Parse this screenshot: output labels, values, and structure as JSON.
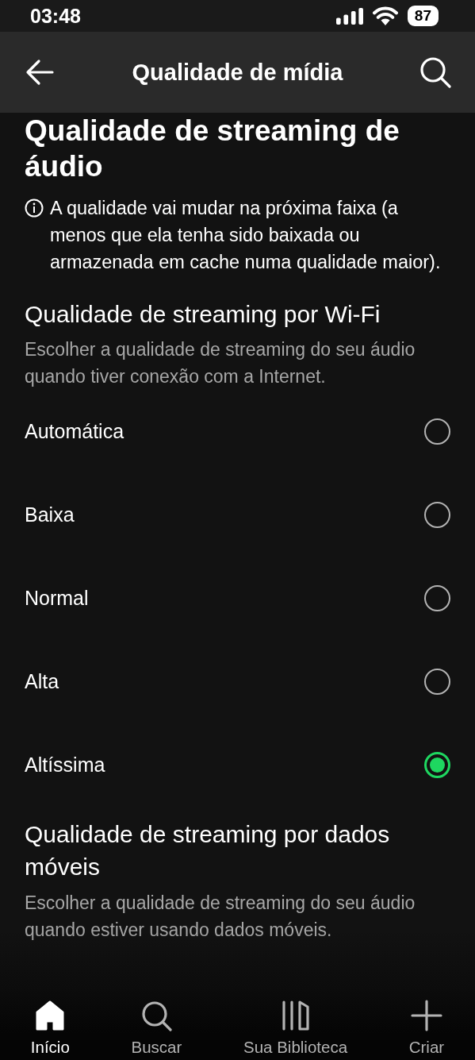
{
  "status_bar": {
    "time": "03:48",
    "battery": "87"
  },
  "header": {
    "title": "Qualidade de mídia"
  },
  "section": {
    "title": "Qualidade de streaming de áudio",
    "info": "A qualidade vai mudar na próxima faixa (a menos que ela tenha sido baixada ou armazenada em cache numa qualidade maior)."
  },
  "groups": [
    {
      "title": "Qualidade de streaming por Wi-Fi",
      "description": "Escolher a qualidade de streaming do seu áudio quando tiver conexão com a Internet.",
      "options": [
        {
          "label": "Automática",
          "selected": false
        },
        {
          "label": "Baixa",
          "selected": false
        },
        {
          "label": "Normal",
          "selected": false
        },
        {
          "label": "Alta",
          "selected": false
        },
        {
          "label": "Altíssima",
          "selected": true
        }
      ]
    },
    {
      "title": "Qualidade de streaming por dados móveis",
      "description": "Escolher a qualidade de streaming do seu áudio quando estiver usando dados móveis."
    }
  ],
  "nav": [
    {
      "label": "Início",
      "kind": "home",
      "selected": true
    },
    {
      "label": "Buscar",
      "kind": "search",
      "selected": false
    },
    {
      "label": "Sua Biblioteca",
      "kind": "library",
      "selected": false
    },
    {
      "label": "Criar",
      "kind": "plus",
      "selected": false
    }
  ]
}
